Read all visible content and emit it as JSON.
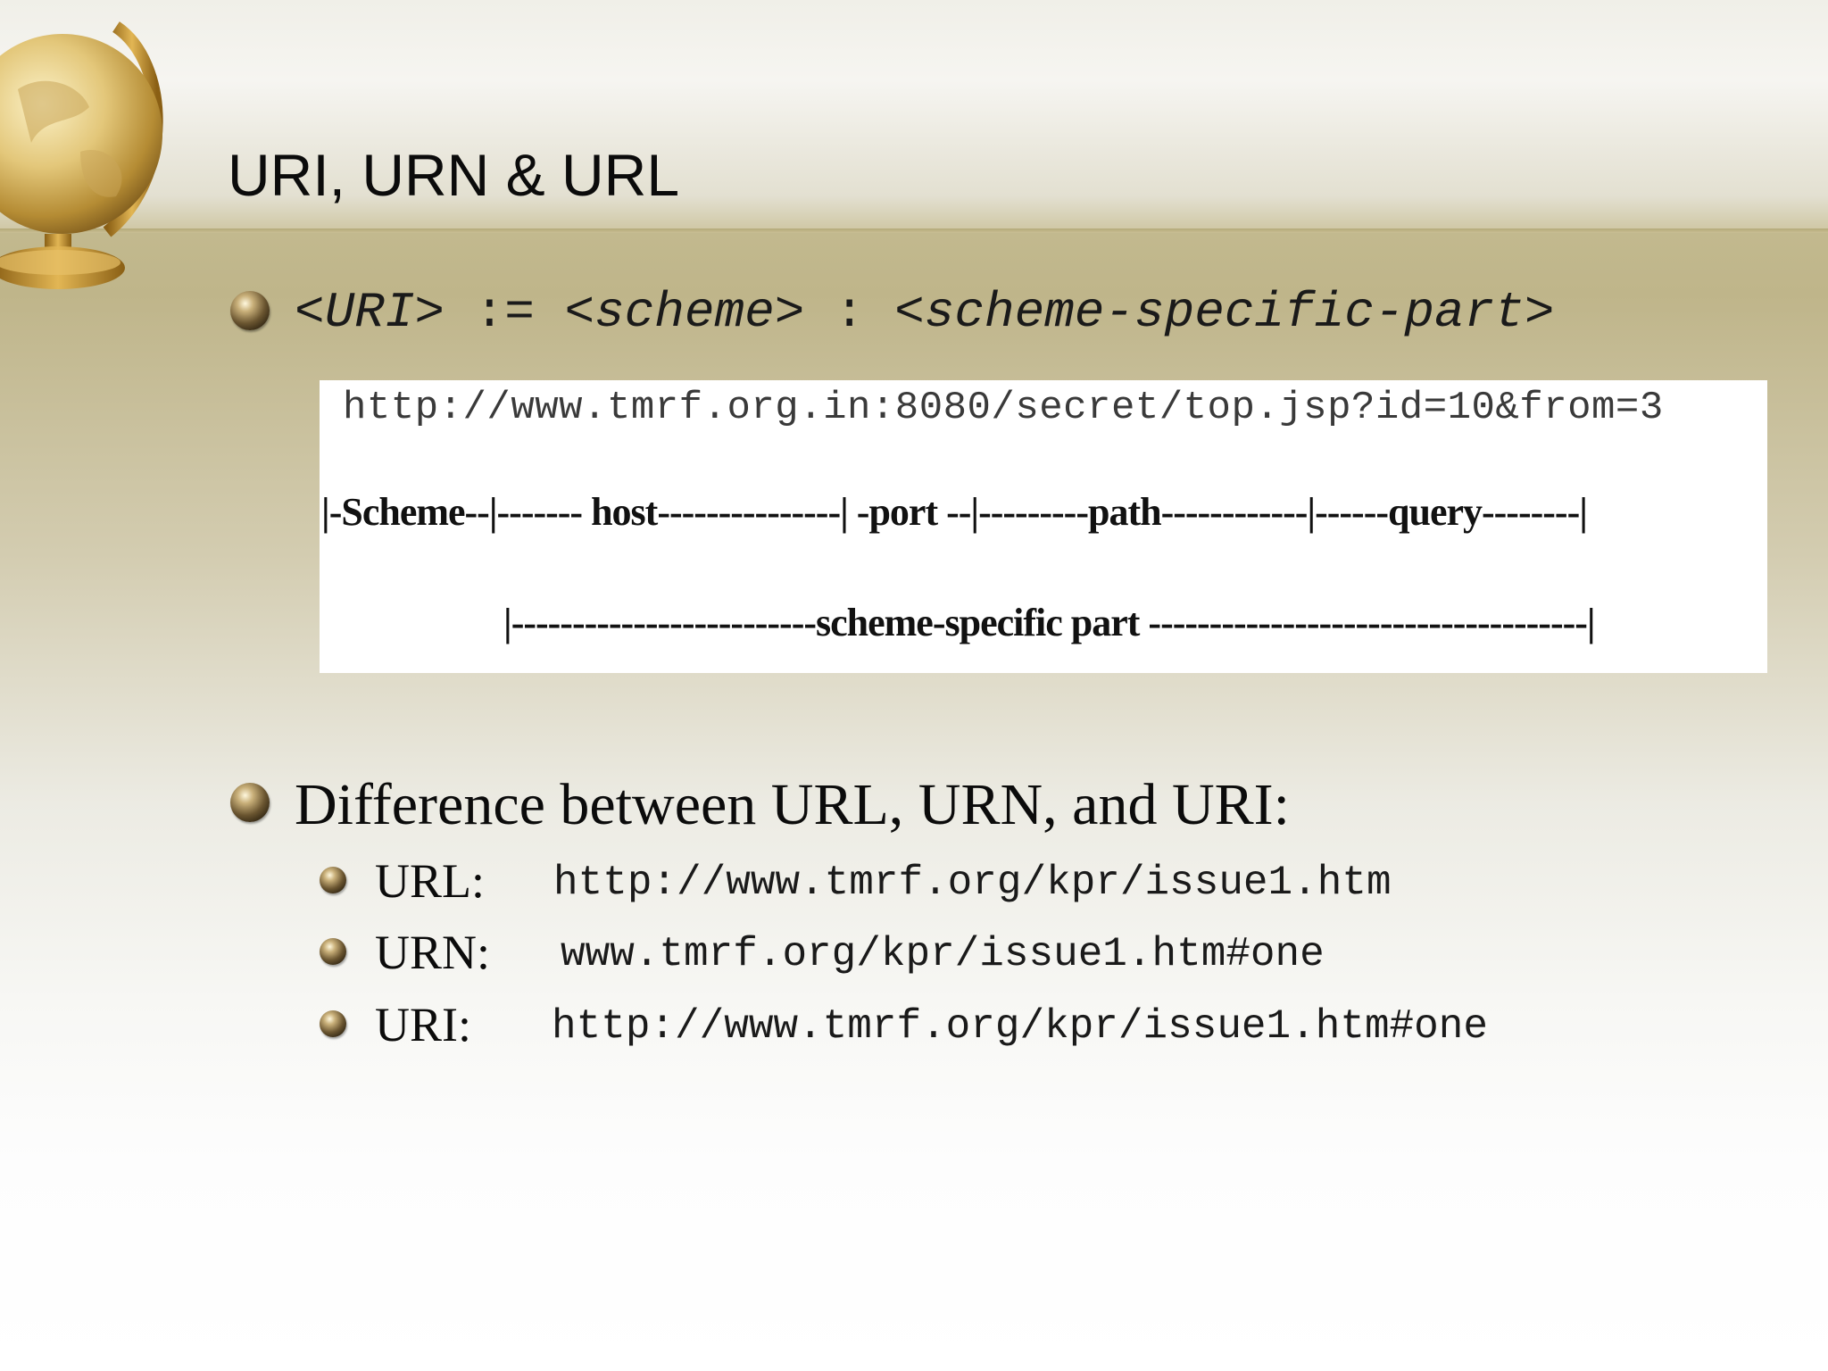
{
  "slide": {
    "title": "URI, URN & URL",
    "syntax": {
      "uri": "<URI>",
      "assign": ":=",
      "scheme": "<scheme>",
      "colon": ":",
      "ssp": "<scheme-specific-part>"
    },
    "diagram": {
      "url": "http://www.tmrf.org.in:8080/secret/top.jsp?id=10&from=3",
      "parts": "|-Scheme--|------- host---------------| -port --|---------path------------|------query--------|",
      "ssp_line": "|-------------------------scheme-specific part ------------------------------------|"
    },
    "difference": {
      "heading": "Difference between URL, URN, and URI:",
      "items": [
        {
          "label": "URL:",
          "value": "http://www.tmrf.org/kpr/issue1.htm"
        },
        {
          "label": "URN:",
          "value": "www.tmrf.org/kpr/issue1.htm#one"
        },
        {
          "label": "URI:",
          "value": "http://www.tmrf.org/kpr/issue1.htm#one"
        }
      ]
    }
  },
  "icons": {
    "decor": "globe-icon",
    "bullet": "sphere-bullet-icon"
  }
}
